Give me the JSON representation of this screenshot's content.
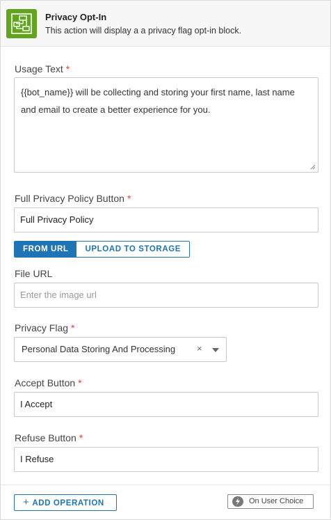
{
  "header": {
    "title": "Privacy Opt-In",
    "subtitle": "This action will display a a privacy flag opt-in block."
  },
  "usage": {
    "label": "Usage Text",
    "required": "*",
    "value": "{{bot_name}} will be collecting and storing your first name, last name and email to create a better experience for you."
  },
  "policy_button": {
    "label": "Full Privacy Policy Button",
    "required": "*",
    "value": "Full Privacy Policy"
  },
  "source_tabs": {
    "from_url": "FROM URL",
    "upload": "UPLOAD TO STORAGE"
  },
  "file_url": {
    "label": "File URL",
    "placeholder": "Enter the image url"
  },
  "privacy_flag": {
    "label": "Privacy Flag",
    "required": "*",
    "value": "Personal Data Storing And Processing",
    "clear": "×"
  },
  "accept_button": {
    "label": "Accept Button",
    "required": "*",
    "value": "I Accept"
  },
  "refuse_button": {
    "label": "Refuse Button",
    "required": "*",
    "value": "I Refuse"
  },
  "footer": {
    "add_operation": "ADD OPERATION",
    "add_icon": "+",
    "on_user_choice": "On User Choice"
  },
  "colors": {
    "accent": "#1f74b5",
    "icon_bg": "#62a420",
    "required": "#e0413a"
  }
}
